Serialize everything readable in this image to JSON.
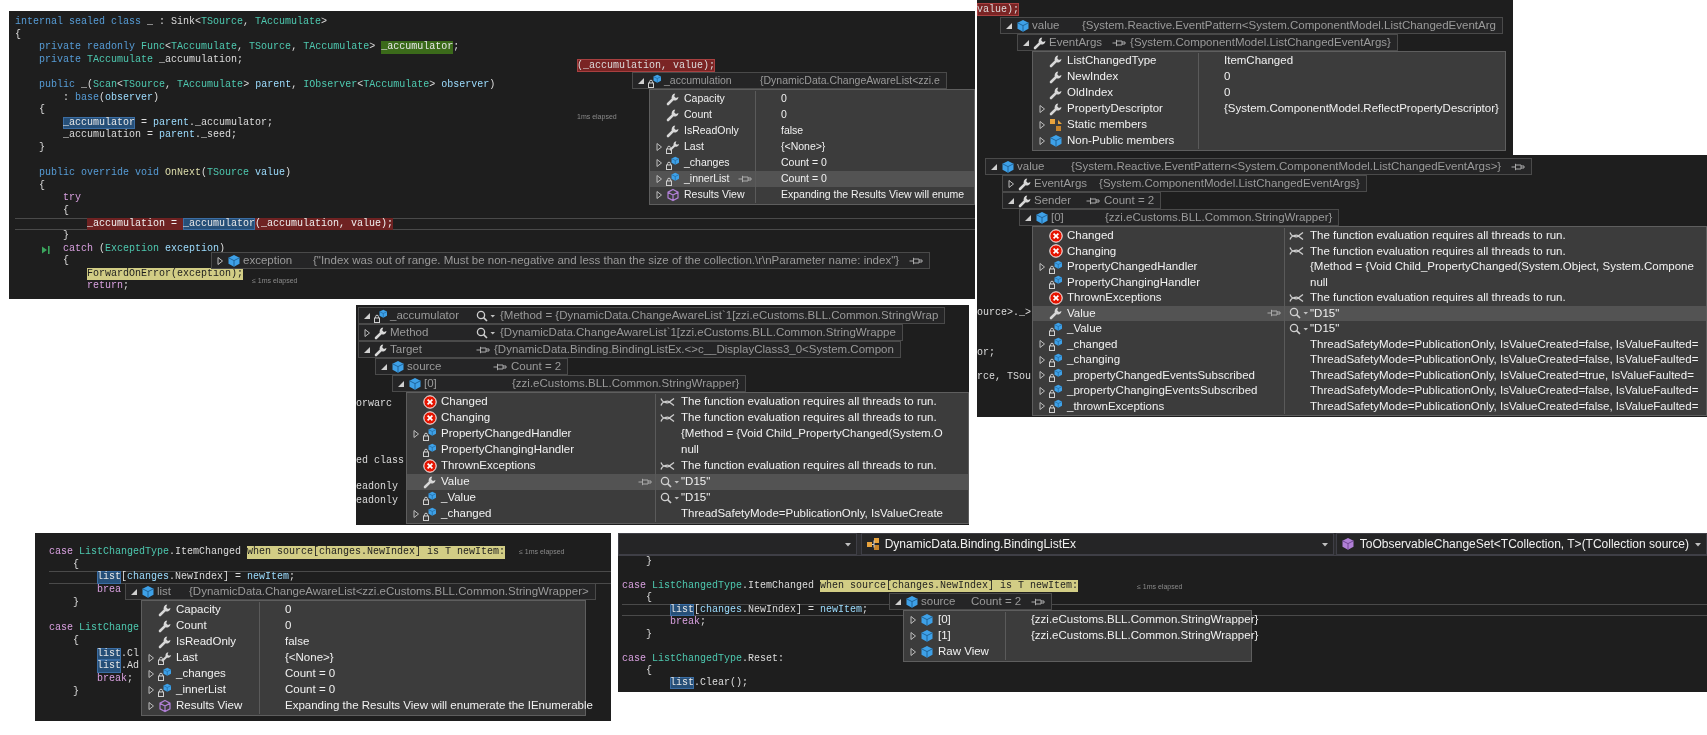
{
  "panels": [
    {
      "code_lines": [
        {
          "kind": "code",
          "current": false,
          "tokens": [
            {
              "text": "internal sealed class",
              "kind": "kw"
            },
            {
              "text": " _ : Sink<",
              "kind": "pl"
            },
            {
              "text": "TSource",
              "kind": "ty"
            },
            {
              "text": ", ",
              "kind": "pl"
            },
            {
              "text": "TAccumulate",
              "kind": "ty"
            },
            {
              "text": ">",
              "kind": "pl"
            }
          ]
        },
        {
          "kind": "code",
          "current": false,
          "tokens": [
            {
              "text": "{",
              "kind": "pl"
            }
          ]
        },
        {
          "kind": "code",
          "current": false,
          "tokens": [
            {
              "text": "    private readonly ",
              "kind": "kw"
            },
            {
              "text": "Func",
              "kind": "ty"
            },
            {
              "text": "<",
              "kind": "pl"
            },
            {
              "text": "TAccumulate",
              "kind": "ty"
            },
            {
              "text": ", ",
              "kind": "pl"
            },
            {
              "text": "TSource",
              "kind": "ty"
            },
            {
              "text": ", ",
              "kind": "pl"
            },
            {
              "text": "TAccumulate",
              "kind": "ty"
            },
            {
              "text": "> ",
              "kind": "pl"
            },
            {
              "text": "_accumulator",
              "kind": "definition"
            },
            {
              "text": ";",
              "kind": "pl"
            }
          ]
        },
        {
          "kind": "code",
          "current": false,
          "tokens": [
            {
              "text": "    private ",
              "kind": "kw"
            },
            {
              "text": "TAccumulate",
              "kind": "ty"
            },
            {
              "text": " _accumulation;",
              "kind": "pl"
            }
          ]
        },
        {
          "kind": "blank",
          "current": false
        },
        {
          "kind": "code",
          "current": false,
          "tokens": [
            {
              "text": "    public ",
              "kind": "kw"
            },
            {
              "text": "_(",
              "kind": "pl"
            },
            {
              "text": "Scan",
              "kind": "ty"
            },
            {
              "text": "<",
              "kind": "pl"
            },
            {
              "text": "TSource",
              "kind": "ty"
            },
            {
              "text": ", ",
              "kind": "pl"
            },
            {
              "text": "TAccumulate",
              "kind": "ty"
            },
            {
              "text": "> ",
              "kind": "pl"
            },
            {
              "text": "parent",
              "kind": "var"
            },
            {
              "text": ", ",
              "kind": "pl"
            },
            {
              "text": "IObserver",
              "kind": "ty"
            },
            {
              "text": "<",
              "kind": "pl"
            },
            {
              "text": "TAccumulate",
              "kind": "ty"
            },
            {
              "text": "> ",
              "kind": "pl"
            },
            {
              "text": "observer",
              "kind": "var"
            },
            {
              "text": ")",
              "kind": "pl"
            }
          ]
        },
        {
          "kind": "code",
          "current": false,
          "tokens": [
            {
              "text": "        : ",
              "kind": "pl"
            },
            {
              "text": "base",
              "kind": "kw"
            },
            {
              "text": "(",
              "kind": "pl"
            },
            {
              "text": "observer",
              "kind": "var"
            },
            {
              "text": ")",
              "kind": "pl"
            }
          ]
        },
        {
          "kind": "code",
          "current": false,
          "tokens": [
            {
              "text": "    {",
              "kind": "pl"
            }
          ]
        },
        {
          "kind": "code",
          "current": false,
          "tokens": [
            {
              "text": "        _accumulator",
              "kind": "reference"
            },
            {
              "text": " = ",
              "kind": "pl"
            },
            {
              "text": "parent",
              "kind": "var"
            },
            {
              "text": "._accumulator;",
              "kind": "pl"
            }
          ]
        },
        {
          "kind": "code",
          "current": false,
          "tokens": [
            {
              "text": "        _accumulation = ",
              "kind": "pl"
            },
            {
              "text": "parent",
              "kind": "var"
            },
            {
              "text": "._seed;",
              "kind": "pl"
            }
          ]
        },
        {
          "kind": "code",
          "current": false,
          "tokens": [
            {
              "text": "    }",
              "kind": "pl"
            }
          ]
        },
        {
          "kind": "blank",
          "current": false
        },
        {
          "kind": "code",
          "current": false,
          "tokens": [
            {
              "text": "    public override void ",
              "kind": "kw"
            },
            {
              "text": "OnNext",
              "kind": "fn"
            },
            {
              "text": "(",
              "kind": "pl"
            },
            {
              "text": "TSource ",
              "kind": "ty"
            },
            {
              "text": "value",
              "kind": "var"
            },
            {
              "text": ")",
              "kind": "pl"
            }
          ]
        },
        {
          "kind": "code",
          "current": false,
          "tokens": [
            {
              "text": "    {",
              "kind": "pl"
            }
          ]
        },
        {
          "kind": "code",
          "current": false,
          "tokens": [
            {
              "text": "        try",
              "kind": "ctl"
            }
          ]
        },
        {
          "kind": "code",
          "current": false,
          "tokens": [
            {
              "text": "        {",
              "kind": "pl"
            }
          ]
        },
        {
          "kind": "code",
          "current": true,
          "tokens": [
            {
              "text": "            _accumulation = ",
              "kind": "exception"
            },
            {
              "text": "_accumulator",
              "kind": "reference"
            },
            {
              "text": "(_accumulation, value);",
              "kind": "exception"
            }
          ]
        },
        {
          "kind": "code",
          "current": false,
          "tokens": [
            {
              "text": "        }",
              "kind": "pl"
            }
          ]
        },
        {
          "kind": "marked",
          "current": false,
          "tokens": [
            {
              "text": "        catch",
              "kind": "ctl"
            },
            {
              "text": " (",
              "kind": "pl"
            },
            {
              "text": "Exception ",
              "kind": "ty"
            },
            {
              "text": "exception",
              "kind": "var"
            },
            {
              "text": ")",
              "kind": "pl"
            }
          ]
        },
        {
          "kind": "code",
          "current": false,
          "tokens": [
            {
              "text": "        {",
              "kind": "pl"
            }
          ]
        },
        {
          "kind": "code",
          "current": false,
          "tokens": [
            {
              "text": "            ForwardOnError(exception);",
              "kind": "current"
            }
          ]
        },
        {
          "kind": "code",
          "current": false,
          "tokens": [
            {
              "text": "            return",
              "kind": "ctl"
            },
            {
              "text": ";",
              "kind": "pl"
            }
          ]
        }
      ],
      "code_fragments": [
        {
          "text": "(_accumulation, value);",
          "kind": "exception"
        }
      ],
      "elapsed_labels": [
        "1ms elapsed",
        "≤ 1ms elapsed"
      ],
      "datatips": [
        {
          "headers": [
            {
              "name": "_accumulation",
              "value": "{DynamicData.ChangeAwareList<zzi.e",
              "kind": "field",
              "expanded": true,
              "pinned": false
            }
          ],
          "rows": [
            {
              "name": "Capacity",
              "value": "0",
              "kind": "property",
              "expandable": false,
              "selected": false
            },
            {
              "name": "Count",
              "value": "0",
              "kind": "property",
              "expandable": false,
              "selected": false
            },
            {
              "name": "IsReadOnly",
              "value": "false",
              "kind": "property",
              "expandable": false,
              "selected": false
            },
            {
              "name": "Last",
              "value": "{<None>}",
              "kind": "locked-property",
              "expandable": true,
              "selected": false
            },
            {
              "name": "_changes",
              "value": "Count = 0",
              "kind": "field",
              "expandable": true,
              "selected": false
            },
            {
              "name": "_innerList",
              "value": "Count = 0",
              "kind": "field",
              "expandable": true,
              "selected": true
            },
            {
              "name": "Results View",
              "value": "Expanding the Results View will enume",
              "kind": "results",
              "expandable": true,
              "selected": false
            }
          ]
        },
        {
          "headers": [
            {
              "name": "exception",
              "value": "{\"Index was out of range. Must be non-negative and less than the size of the collection.\\r\\nParameter name: index\"}",
              "kind": "object",
              "expanded": false,
              "pinned": true
            }
          ]
        }
      ]
    },
    {
      "code_fragments": [
        {
          "text": "value);",
          "kind": "exception"
        }
      ],
      "datatips": [
        {
          "headers": [
            {
              "name": "value",
              "value": "{System.Reactive.EventPattern<System.ComponentModel.ListChangedEventArg",
              "kind": "object",
              "expanded": true,
              "pinned": false,
              "children": [
                {
                  "name": "EventArgs",
                  "value": "{System.ComponentModel.ListChangedEventArgs}",
                  "kind": "property",
                  "expanded": true,
                  "pinned": true
                }
              ]
            }
          ],
          "rows": [
            {
              "name": "ListChangedType",
              "value": "ItemChanged",
              "kind": "property",
              "expandable": false,
              "selected": false
            },
            {
              "name": "NewIndex",
              "value": "0",
              "kind": "property",
              "expandable": false,
              "selected": false
            },
            {
              "name": "OldIndex",
              "value": "0",
              "kind": "property",
              "expandable": false,
              "selected": false
            },
            {
              "name": "PropertyDescriptor",
              "value": "{System.ComponentModel.ReflectPropertyDescriptor}",
              "kind": "property",
              "expandable": true,
              "selected": false
            },
            {
              "name": "Static members",
              "kind": "static",
              "expandable": true,
              "selected": false
            },
            {
              "name": "Non-Public members",
              "kind": "object",
              "expandable": true,
              "selected": false
            }
          ]
        }
      ]
    },
    {
      "code_fragments": [
        {
          "text": "ource>._>",
          "kind": "plain"
        },
        {
          "text": "or;",
          "kind": "plain"
        },
        {
          "text": "rce, TSou",
          "kind": "plain"
        }
      ],
      "datatips": [
        {
          "headers": [
            {
              "name": "value",
              "value": "{System.Reactive.EventPattern<System.ComponentModel.ListChangedEventArgs>}",
              "kind": "object",
              "expanded": true,
              "pinned": true,
              "children": [
                {
                  "name": "EventArgs",
                  "value": "{System.ComponentModel.ListChangedEventArgs}",
                  "kind": "property",
                  "expanded": false,
                  "pinned": false
                },
                {
                  "name": "Sender",
                  "value": "Count = 2",
                  "kind": "property",
                  "expanded": true,
                  "pinned": true,
                  "children": [
                    {
                      "name": "[0]",
                      "value": "{zzi.eCustoms.BLL.Common.StringWrapper}",
                      "kind": "object",
                      "expanded": true,
                      "pinned": false
                    }
                  ]
                }
              ]
            }
          ],
          "rows": [
            {
              "name": "Changed",
              "value": "The function evaluation requires all threads to run.",
              "kind": "error",
              "expandable": false,
              "selected": false
            },
            {
              "name": "Changing",
              "value": "The function evaluation requires all threads to run.",
              "kind": "error",
              "expandable": false,
              "selected": false
            },
            {
              "name": "PropertyChangedHandler",
              "value": "{Method = {Void Child_PropertyChanged(System.Object, System.Compone",
              "kind": "field",
              "expandable": true,
              "selected": false
            },
            {
              "name": "PropertyChangingHandler",
              "value": "null",
              "kind": "field",
              "expandable": false,
              "selected": false
            },
            {
              "name": "ThrownExceptions",
              "value": "The function evaluation requires all threads to run.",
              "kind": "error",
              "expandable": false,
              "selected": false
            },
            {
              "name": "Value",
              "value": "\"D15\"",
              "kind": "string-property",
              "expandable": false,
              "selected": true
            },
            {
              "name": "_Value",
              "value": "\"D15\"",
              "kind": "string-field",
              "expandable": false,
              "selected": false
            },
            {
              "name": "_changed",
              "value": "ThreadSafetyMode=PublicationOnly, IsValueCreated=false, IsValueFaulted=",
              "kind": "field",
              "expandable": true,
              "selected": false
            },
            {
              "name": "_changing",
              "value": "ThreadSafetyMode=PublicationOnly, IsValueCreated=false, IsValueFaulted=",
              "kind": "field",
              "expandable": true,
              "selected": false
            },
            {
              "name": "_propertyChangedEventsSubscribed",
              "value": "ThreadSafetyMode=PublicationOnly, IsValueCreated=true, IsValueFaulted=",
              "kind": "field",
              "expandable": true,
              "selected": false
            },
            {
              "name": "_propertyChangingEventsSubscribed",
              "value": "ThreadSafetyMode=PublicationOnly, IsValueCreated=false, IsValueFaulted=",
              "kind": "field",
              "expandable": true,
              "selected": false
            },
            {
              "name": "_thrownExceptions",
              "value": "ThreadSafetyMode=PublicationOnly, IsValueCreated=false, IsValueFaulted=",
              "kind": "field",
              "expandable": true,
              "selected": false
            }
          ]
        }
      ]
    },
    {
      "code_fragments": [
        {
          "text": "orwarc",
          "kind": "plain"
        },
        {
          "text": "ed class",
          "kind": "plain"
        },
        {
          "text": "eadonly",
          "kind": "plain"
        },
        {
          "text": "eadonly",
          "kind": "plain"
        }
      ],
      "datatips": [
        {
          "headers": [
            {
              "name": "_accumulator",
              "value": "{Method = {DynamicData.ChangeAwareList`1[zzi.eCustoms.BLL.Common.StringWrap",
              "kind": "delegate-field",
              "expanded": true,
              "pinned": false
            },
            {
              "name": "Method",
              "value": "{DynamicData.ChangeAwareList`1[zzi.eCustoms.BLL.Common.StringWrappe",
              "kind": "delegate-property",
              "expanded": false,
              "pinned": false
            },
            {
              "name": "Target",
              "value": "{DynamicData.Binding.BindingListEx.<>c__DisplayClass3_0<System.Compon",
              "kind": "property",
              "expanded": true,
              "pinned": true,
              "children": [
                {
                  "name": "source",
                  "value": "Count = 2",
                  "kind": "object",
                  "expanded": true,
                  "pinned": true,
                  "children": [
                    {
                      "name": "[0]",
                      "value": "{zzi.eCustoms.BLL.Common.StringWrapper}",
                      "kind": "object",
                      "expanded": true,
                      "pinned": false
                    }
                  ]
                }
              ]
            }
          ],
          "rows": [
            {
              "name": "Changed",
              "value": "The function evaluation requires all threads to run.",
              "kind": "error",
              "expandable": false,
              "selected": false
            },
            {
              "name": "Changing",
              "value": "The function evaluation requires all threads to run.",
              "kind": "error",
              "expandable": false,
              "selected": false
            },
            {
              "name": "PropertyChangedHandler",
              "value": "{Method = {Void Child_PropertyChanged(System.O",
              "kind": "field",
              "expandable": true,
              "selected": false
            },
            {
              "name": "PropertyChangingHandler",
              "value": "null",
              "kind": "field",
              "expandable": false,
              "selected": false
            },
            {
              "name": "ThrownExceptions",
              "value": "The function evaluation requires all threads to run.",
              "kind": "error",
              "expandable": false,
              "selected": false
            },
            {
              "name": "Value",
              "value": "\"D15\"",
              "kind": "string-property",
              "expandable": false,
              "selected": true
            },
            {
              "name": "_Value",
              "value": "\"D15\"",
              "kind": "string-field",
              "expandable": false,
              "selected": false
            },
            {
              "name": "_changed",
              "value": "ThreadSafetyMode=PublicationOnly, IsValueCreate",
              "kind": "field",
              "expandable": true,
              "selected": false
            }
          ]
        }
      ]
    },
    {
      "code_lines": [
        {
          "kind": "code",
          "current": false,
          "tokens": [
            {
              "text": "case ",
              "kind": "ctl"
            },
            {
              "text": "ListChangedType",
              "kind": "ty"
            },
            {
              "text": ".ItemChanged ",
              "kind": "pl"
            },
            {
              "text": "when source[changes.NewIndex] is T newItem:",
              "kind": "current"
            }
          ]
        },
        {
          "kind": "code",
          "current": false,
          "tokens": [
            {
              "text": "    {",
              "kind": "pl"
            }
          ]
        },
        {
          "kind": "code",
          "current": true,
          "tokens": [
            {
              "text": "        list",
              "kind": "reference"
            },
            {
              "text": "[",
              "kind": "pl"
            },
            {
              "text": "changes",
              "kind": "var"
            },
            {
              "text": ".NewIndex] = ",
              "kind": "pl"
            },
            {
              "text": "newItem",
              "kind": "var"
            },
            {
              "text": ";",
              "kind": "pl"
            }
          ]
        },
        {
          "kind": "code",
          "current": false,
          "tokens": [
            {
              "text": "        brea",
              "kind": "ctl"
            }
          ]
        },
        {
          "kind": "code",
          "current": false,
          "tokens": [
            {
              "text": "    }",
              "kind": "pl"
            }
          ]
        },
        {
          "kind": "blank",
          "current": false
        },
        {
          "kind": "code",
          "current": false,
          "tokens": [
            {
              "text": "case ",
              "kind": "ctl"
            },
            {
              "text": "ListChange",
              "kind": "ty"
            }
          ]
        },
        {
          "kind": "code",
          "current": false,
          "tokens": [
            {
              "text": "    {",
              "kind": "pl"
            }
          ]
        },
        {
          "kind": "code",
          "current": false,
          "tokens": [
            {
              "text": "        list",
              "kind": "reference"
            },
            {
              "text": ".Cl",
              "kind": "pl"
            }
          ]
        },
        {
          "kind": "code",
          "current": false,
          "tokens": [
            {
              "text": "        list",
              "kind": "reference"
            },
            {
              "text": ".Ad",
              "kind": "pl"
            }
          ]
        },
        {
          "kind": "code",
          "current": false,
          "tokens": [
            {
              "text": "        break",
              "kind": "ctl"
            },
            {
              "text": ";",
              "kind": "pl"
            }
          ]
        },
        {
          "kind": "code",
          "current": false,
          "tokens": [
            {
              "text": "    }",
              "kind": "pl"
            }
          ]
        }
      ],
      "elapsed_labels": [
        "≤ 1ms elapsed"
      ],
      "datatips": [
        {
          "headers": [
            {
              "name": "list",
              "value": "{DynamicData.ChangeAwareList<zzi.eCustoms.BLL.Common.StringWrapper>",
              "kind": "object",
              "expanded": true,
              "pinned": false
            }
          ],
          "rows": [
            {
              "name": "Capacity",
              "value": "0",
              "kind": "property",
              "expandable": false,
              "selected": false
            },
            {
              "name": "Count",
              "value": "0",
              "kind": "property",
              "expandable": false,
              "selected": false
            },
            {
              "name": "IsReadOnly",
              "value": "false",
              "kind": "property",
              "expandable": false,
              "selected": false
            },
            {
              "name": "Last",
              "value": "{<None>}",
              "kind": "locked-property",
              "expandable": true,
              "selected": false
            },
            {
              "name": "_changes",
              "value": "Count = 0",
              "kind": "field",
              "expandable": true,
              "selected": false
            },
            {
              "name": "_innerList",
              "value": "Count = 0",
              "kind": "field",
              "expandable": true,
              "selected": false
            },
            {
              "name": "Results View",
              "value": "Expanding the Results View will enumerate the IEnumerable",
              "kind": "results",
              "expandable": true,
              "selected": false
            }
          ]
        }
      ]
    },
    {
      "navigation_bar": [
        {
          "kind": "empty"
        },
        {
          "kind": "class",
          "text": "DynamicData.Binding.BindingListEx"
        },
        {
          "kind": "method",
          "text": "ToObservableChangeSet<TCollection, T>(TCollection source)"
        }
      ],
      "code_lines": [
        {
          "kind": "code",
          "current": false,
          "tokens": [
            {
              "text": "    }",
              "kind": "pl"
            }
          ]
        },
        {
          "kind": "blank",
          "current": false
        },
        {
          "kind": "code",
          "current": false,
          "tokens": [
            {
              "text": "case ",
              "kind": "ctl"
            },
            {
              "text": "ListChangedType",
              "kind": "ty"
            },
            {
              "text": ".ItemChanged ",
              "kind": "pl"
            },
            {
              "text": "when source[changes.NewIndex] is T newItem:",
              "kind": "current"
            }
          ]
        },
        {
          "kind": "code",
          "current": false,
          "tokens": [
            {
              "text": "    {",
              "kind": "pl"
            }
          ]
        },
        {
          "kind": "code",
          "current": true,
          "tokens": [
            {
              "text": "        list",
              "kind": "reference"
            },
            {
              "text": "[",
              "kind": "pl"
            },
            {
              "text": "changes",
              "kind": "var"
            },
            {
              "text": ".NewIndex] = ",
              "kind": "pl"
            },
            {
              "text": "newItem",
              "kind": "var"
            },
            {
              "text": ";",
              "kind": "pl"
            }
          ]
        },
        {
          "kind": "code",
          "current": false,
          "tokens": [
            {
              "text": "        break",
              "kind": "ctl"
            },
            {
              "text": ";",
              "kind": "pl"
            }
          ]
        },
        {
          "kind": "code",
          "current": false,
          "tokens": [
            {
              "text": "    }",
              "kind": "pl"
            }
          ]
        },
        {
          "kind": "blank",
          "current": false
        },
        {
          "kind": "code",
          "current": false,
          "tokens": [
            {
              "text": "case ",
              "kind": "ctl"
            },
            {
              "text": "ListChangedType",
              "kind": "ty"
            },
            {
              "text": ".Reset:",
              "kind": "pl"
            }
          ]
        },
        {
          "kind": "code",
          "current": false,
          "tokens": [
            {
              "text": "    {",
              "kind": "pl"
            }
          ]
        },
        {
          "kind": "code",
          "current": false,
          "tokens": [
            {
              "text": "        list",
              "kind": "reference"
            },
            {
              "text": ".Clear();",
              "kind": "pl"
            }
          ]
        }
      ],
      "elapsed_labels": [
        "≤ 1ms elapsed"
      ],
      "datatips": [
        {
          "headers": [
            {
              "name": "source",
              "value": "Count = 2",
              "kind": "object",
              "expanded": true,
              "pinned": true
            }
          ],
          "rows": [
            {
              "name": "[0]",
              "value": "{zzi.eCustoms.BLL.Common.StringWrapper}",
              "kind": "object",
              "expandable": true,
              "selected": false
            },
            {
              "name": "[1]",
              "value": "{zzi.eCustoms.BLL.Common.StringWrapper}",
              "kind": "object",
              "expandable": true,
              "selected": false
            },
            {
              "name": "Raw View",
              "kind": "object",
              "expandable": true,
              "selected": false
            }
          ]
        }
      ]
    }
  ]
}
